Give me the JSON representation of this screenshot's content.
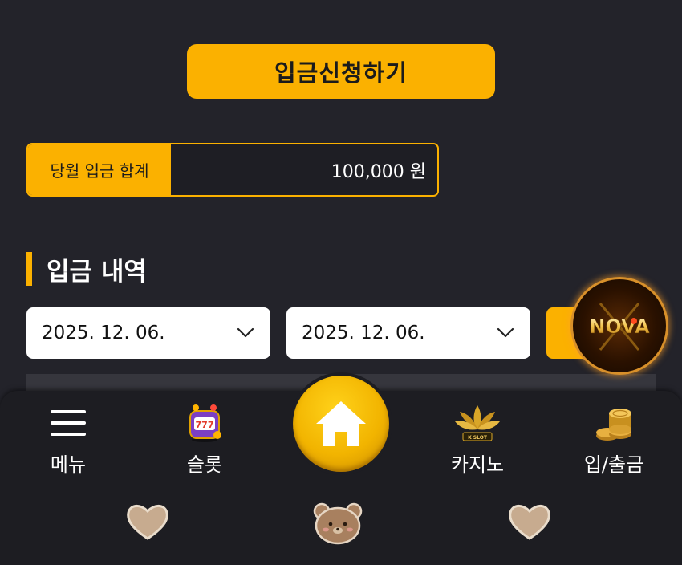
{
  "deposit": {
    "apply_button": "입금신청하기",
    "summary_label": "당월 입금 합계",
    "summary_value": "100,000 원"
  },
  "history": {
    "title": "입금 내역",
    "date_from": "2025. 12. 06.",
    "date_to": "2025. 12. 06."
  },
  "badge": {
    "logo_text": "NOVA"
  },
  "bottom_nav": {
    "menu": "메뉴",
    "slot": "슬롯",
    "casino": "카지노",
    "deposit_withdraw": "입/출금",
    "casino_logo_text": "K SLOT"
  },
  "colors": {
    "accent": "#fbb100",
    "background": "#23232a",
    "nav_background": "#1d1d22"
  }
}
